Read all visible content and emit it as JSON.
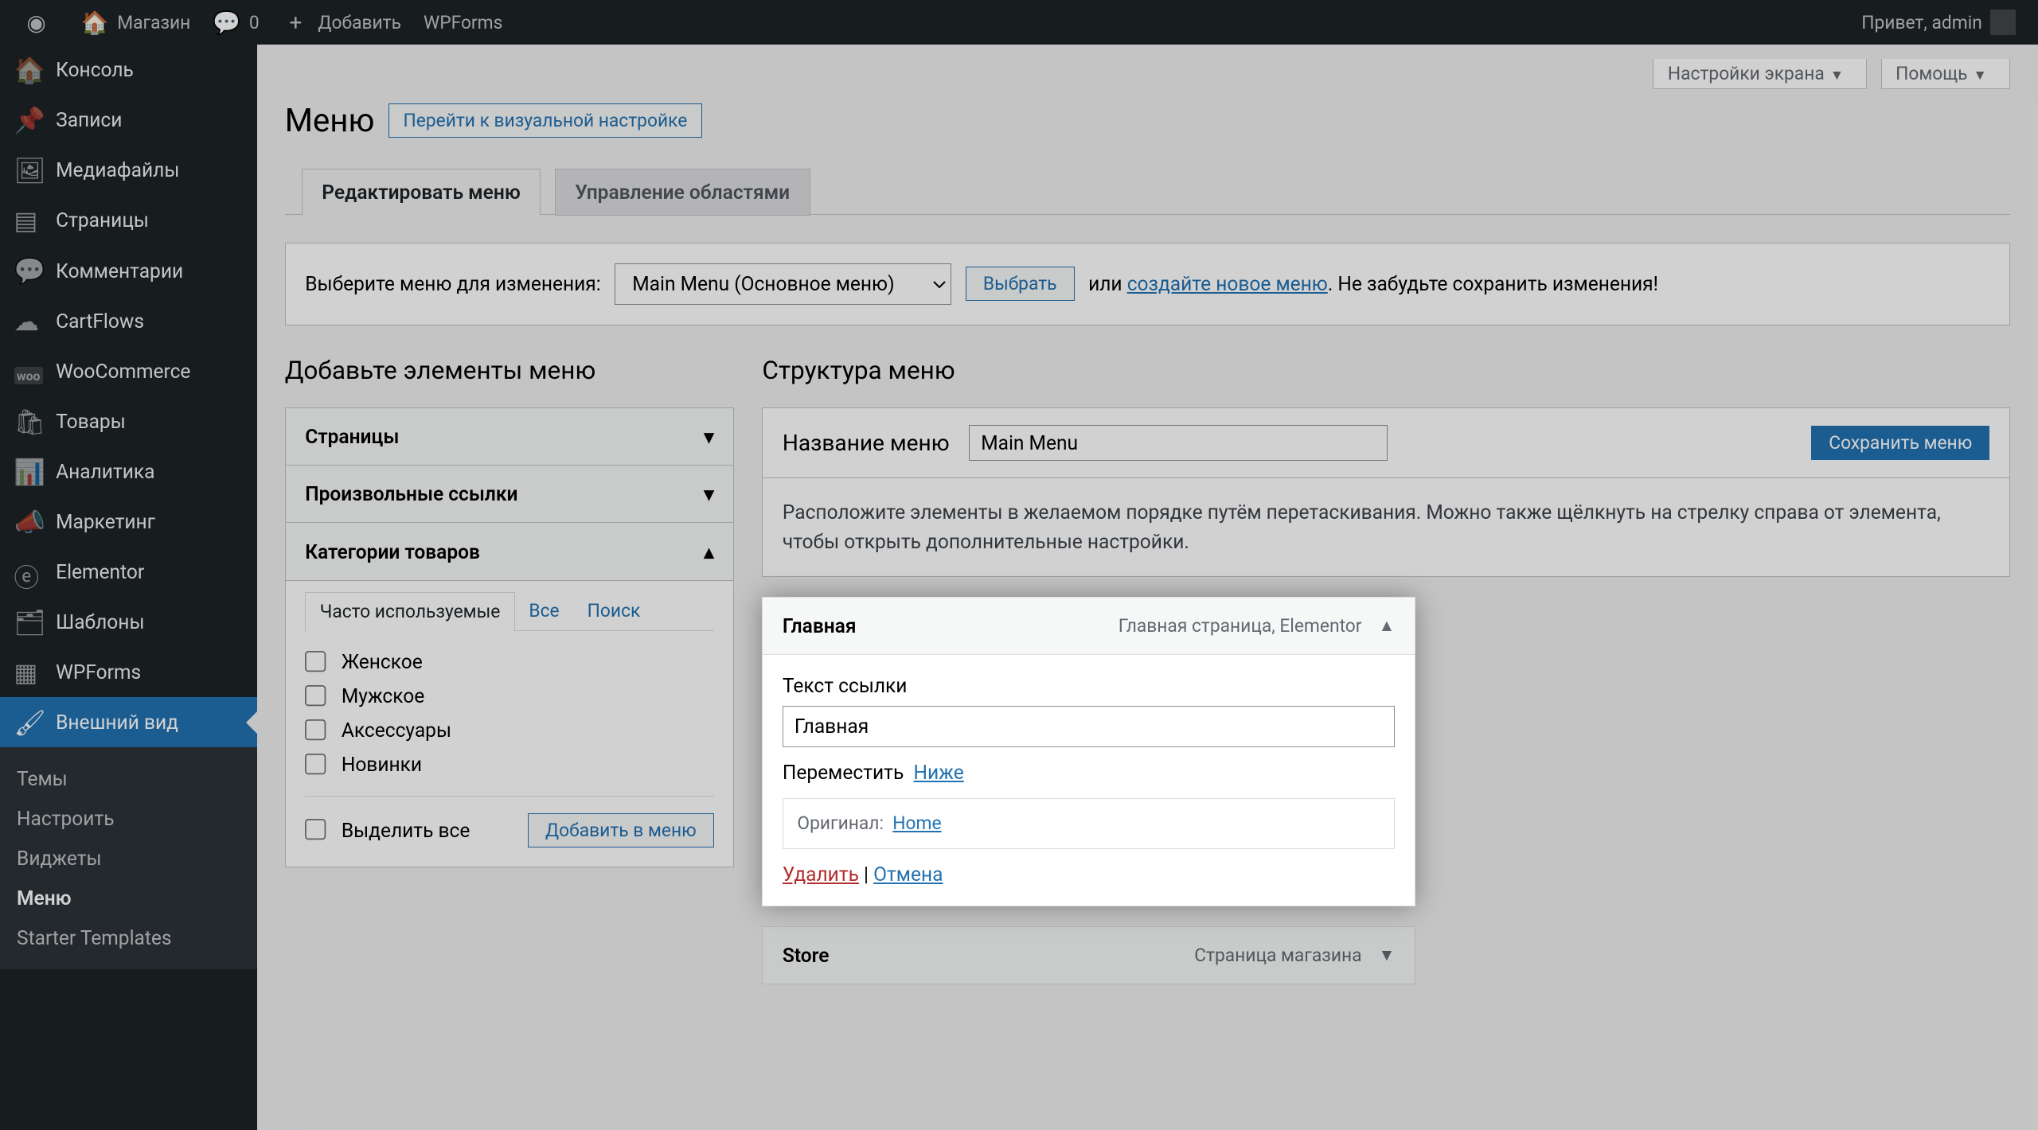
{
  "adminbar": {
    "site": "Магазин",
    "comments": "0",
    "add": "Добавить",
    "wpforms": "WPForms",
    "greeting": "Привет, admin"
  },
  "sidebar": {
    "items": [
      {
        "icon": "🏠",
        "label": "Консоль"
      },
      {
        "icon": "📌",
        "label": "Записи"
      },
      {
        "icon": "🖼",
        "label": "Медиафайлы"
      },
      {
        "icon": "▤",
        "label": "Страницы"
      },
      {
        "icon": "💬",
        "label": "Комментарии"
      },
      {
        "icon": "☁",
        "label": "CartFlows"
      },
      {
        "icon": "woo",
        "label": "WooCommerce"
      },
      {
        "icon": "🛍",
        "label": "Товары"
      },
      {
        "icon": "📊",
        "label": "Аналитика"
      },
      {
        "icon": "📣",
        "label": "Маркетинг"
      },
      {
        "icon": "ⓔ",
        "label": "Elementor"
      },
      {
        "icon": "🗂",
        "label": "Шаблоны"
      },
      {
        "icon": "▦",
        "label": "WPForms"
      },
      {
        "icon": "🖌",
        "label": "Внешний вид"
      }
    ],
    "submenu": [
      "Темы",
      "Настроить",
      "Виджеты",
      "Меню",
      "Starter Templates"
    ]
  },
  "screenMeta": {
    "options": "Настройки экрана",
    "help": "Помощь"
  },
  "title": "Меню",
  "titleAction": "Перейти к визуальной настройке",
  "tabs": [
    "Редактировать меню",
    "Управление областями"
  ],
  "picker": {
    "label": "Выберите меню для изменения:",
    "selected": "Main Menu (Основное меню)",
    "choose": "Выбрать",
    "or": "или",
    "create": "создайте новое меню",
    "remind": ". Не забудьте сохранить изменения!"
  },
  "leftHead": "Добавьте элементы меню",
  "rightHead": "Структура меню",
  "accordion": {
    "pages": "Страницы",
    "links": "Произвольные ссылки",
    "cats": "Категории товаров",
    "tabs": [
      "Часто используемые",
      "Все",
      "Поиск"
    ],
    "checks": [
      "Женское",
      "Мужское",
      "Аксессуары",
      "Новинки"
    ],
    "selectAll": "Выделить все",
    "addBtn": "Добавить в меню"
  },
  "nameLabel": "Название меню",
  "nameValue": "Main Menu",
  "saveBtn": "Сохранить меню",
  "desc": "Расположите элементы в желаемом порядке путём перетаскивания. Можно также щёлкнуть на стрелку справа от элемента, чтобы открыть дополнительные настройки.",
  "item1": {
    "title": "Главная",
    "type": "Главная страница, Elementor",
    "linkTextLabel": "Текст ссылки",
    "linkTextValue": "Главная",
    "moveLabel": "Переместить",
    "moveDown": "Ниже",
    "originalLabel": "Оригинал:",
    "originalLink": "Home",
    "delete": "Удалить",
    "sep": " | ",
    "cancel": "Отмена"
  },
  "item2": {
    "title": "Store",
    "type": "Страница магазина"
  }
}
